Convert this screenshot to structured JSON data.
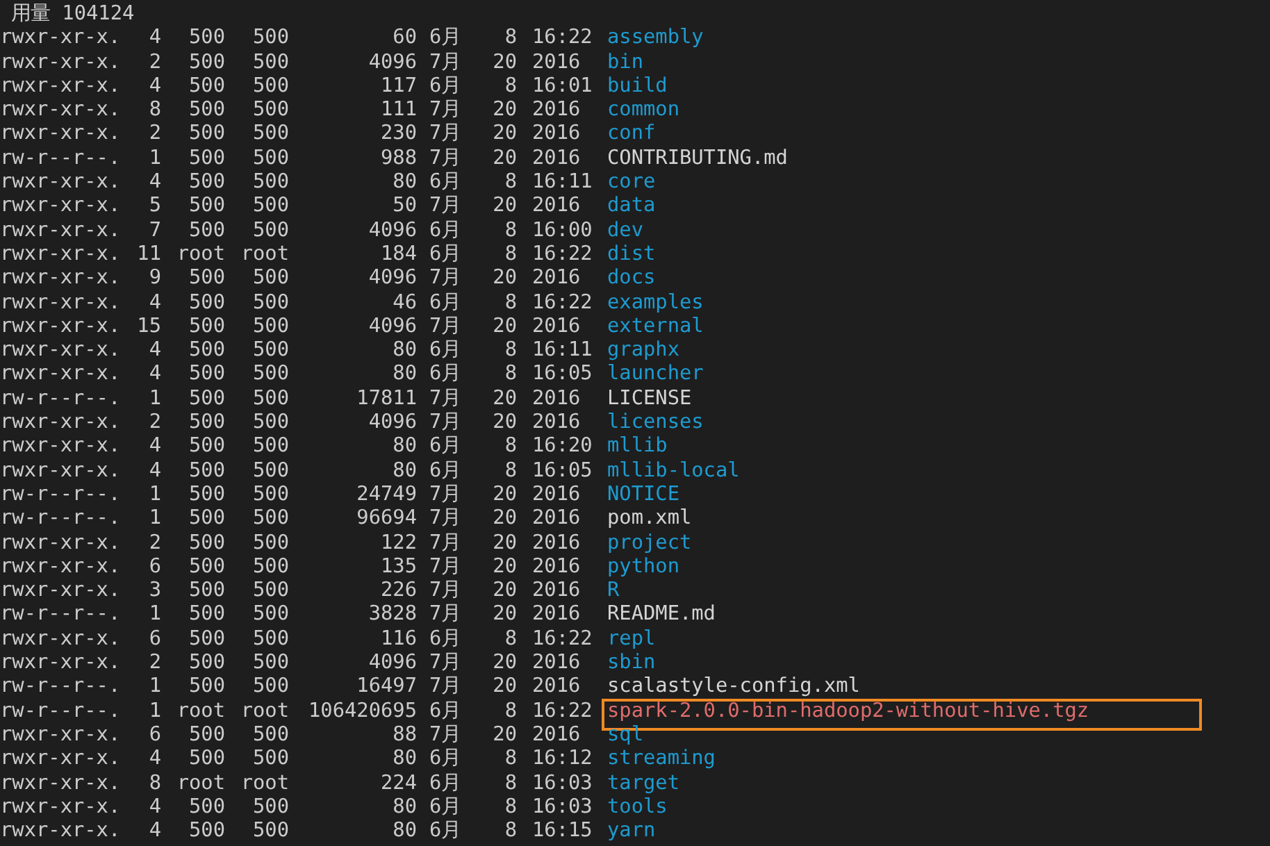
{
  "terminal": {
    "summary": "用量 104124",
    "rows": [
      {
        "permissions": "rwxr-xr-x.",
        "links": "4",
        "owner": "500",
        "group": "500",
        "size": "60",
        "month": "6月",
        "day": "8",
        "time": "16:22",
        "name": "assembly",
        "color": "#1e9bd0",
        "highlighted": false
      },
      {
        "permissions": "rwxr-xr-x.",
        "links": "2",
        "owner": "500",
        "group": "500",
        "size": "4096",
        "month": "7月",
        "day": "20",
        "time": "2016",
        "name": "bin",
        "color": "#1e9bd0",
        "highlighted": false
      },
      {
        "permissions": "rwxr-xr-x.",
        "links": "4",
        "owner": "500",
        "group": "500",
        "size": "117",
        "month": "6月",
        "day": "8",
        "time": "16:01",
        "name": "build",
        "color": "#1e9bd0",
        "highlighted": false
      },
      {
        "permissions": "rwxr-xr-x.",
        "links": "8",
        "owner": "500",
        "group": "500",
        "size": "111",
        "month": "7月",
        "day": "20",
        "time": "2016",
        "name": "common",
        "color": "#1e9bd0",
        "highlighted": false
      },
      {
        "permissions": "rwxr-xr-x.",
        "links": "2",
        "owner": "500",
        "group": "500",
        "size": "230",
        "month": "7月",
        "day": "20",
        "time": "2016",
        "name": "conf",
        "color": "#1e9bd0",
        "highlighted": false
      },
      {
        "permissions": "rw-r--r--.",
        "links": "1",
        "owner": "500",
        "group": "500",
        "size": "988",
        "month": "7月",
        "day": "20",
        "time": "2016",
        "name": "CONTRIBUTING.md",
        "color": "#d4d4d4",
        "highlighted": false
      },
      {
        "permissions": "rwxr-xr-x.",
        "links": "4",
        "owner": "500",
        "group": "500",
        "size": "80",
        "month": "6月",
        "day": "8",
        "time": "16:11",
        "name": "core",
        "color": "#1e9bd0",
        "highlighted": false
      },
      {
        "permissions": "rwxr-xr-x.",
        "links": "5",
        "owner": "500",
        "group": "500",
        "size": "50",
        "month": "7月",
        "day": "20",
        "time": "2016",
        "name": "data",
        "color": "#1e9bd0",
        "highlighted": false
      },
      {
        "permissions": "rwxr-xr-x.",
        "links": "7",
        "owner": "500",
        "group": "500",
        "size": "4096",
        "month": "6月",
        "day": "8",
        "time": "16:00",
        "name": "dev",
        "color": "#1e9bd0",
        "highlighted": false
      },
      {
        "permissions": "rwxr-xr-x.",
        "links": "11",
        "owner": "root",
        "group": "root",
        "size": "184",
        "month": "6月",
        "day": "8",
        "time": "16:22",
        "name": "dist",
        "color": "#1e9bd0",
        "highlighted": false
      },
      {
        "permissions": "rwxr-xr-x.",
        "links": "9",
        "owner": "500",
        "group": "500",
        "size": "4096",
        "month": "7月",
        "day": "20",
        "time": "2016",
        "name": "docs",
        "color": "#1e9bd0",
        "highlighted": false
      },
      {
        "permissions": "rwxr-xr-x.",
        "links": "4",
        "owner": "500",
        "group": "500",
        "size": "46",
        "month": "6月",
        "day": "8",
        "time": "16:22",
        "name": "examples",
        "color": "#1e9bd0",
        "highlighted": false
      },
      {
        "permissions": "rwxr-xr-x.",
        "links": "15",
        "owner": "500",
        "group": "500",
        "size": "4096",
        "month": "7月",
        "day": "20",
        "time": "2016",
        "name": "external",
        "color": "#1e9bd0",
        "highlighted": false
      },
      {
        "permissions": "rwxr-xr-x.",
        "links": "4",
        "owner": "500",
        "group": "500",
        "size": "80",
        "month": "6月",
        "day": "8",
        "time": "16:11",
        "name": "graphx",
        "color": "#1e9bd0",
        "highlighted": false
      },
      {
        "permissions": "rwxr-xr-x.",
        "links": "4",
        "owner": "500",
        "group": "500",
        "size": "80",
        "month": "6月",
        "day": "8",
        "time": "16:05",
        "name": "launcher",
        "color": "#1e9bd0",
        "highlighted": false
      },
      {
        "permissions": "rw-r--r--.",
        "links": "1",
        "owner": "500",
        "group": "500",
        "size": "17811",
        "month": "7月",
        "day": "20",
        "time": "2016",
        "name": "LICENSE",
        "color": "#d4d4d4",
        "highlighted": false
      },
      {
        "permissions": "rwxr-xr-x.",
        "links": "2",
        "owner": "500",
        "group": "500",
        "size": "4096",
        "month": "7月",
        "day": "20",
        "time": "2016",
        "name": "licenses",
        "color": "#1e9bd0",
        "highlighted": false
      },
      {
        "permissions": "rwxr-xr-x.",
        "links": "4",
        "owner": "500",
        "group": "500",
        "size": "80",
        "month": "6月",
        "day": "8",
        "time": "16:20",
        "name": "mllib",
        "color": "#1e9bd0",
        "highlighted": false
      },
      {
        "permissions": "rwxr-xr-x.",
        "links": "4",
        "owner": "500",
        "group": "500",
        "size": "80",
        "month": "6月",
        "day": "8",
        "time": "16:05",
        "name": "mllib-local",
        "color": "#1e9bd0",
        "highlighted": false
      },
      {
        "permissions": "rw-r--r--.",
        "links": "1",
        "owner": "500",
        "group": "500",
        "size": "24749",
        "month": "7月",
        "day": "20",
        "time": "2016",
        "name": "NOTICE",
        "color": "#1e9bd0",
        "highlighted": false
      },
      {
        "permissions": "rw-r--r--.",
        "links": "1",
        "owner": "500",
        "group": "500",
        "size": "96694",
        "month": "7月",
        "day": "20",
        "time": "2016",
        "name": "pom.xml",
        "color": "#d4d4d4",
        "highlighted": false
      },
      {
        "permissions": "rwxr-xr-x.",
        "links": "2",
        "owner": "500",
        "group": "500",
        "size": "122",
        "month": "7月",
        "day": "20",
        "time": "2016",
        "name": "project",
        "color": "#1e9bd0",
        "highlighted": false
      },
      {
        "permissions": "rwxr-xr-x.",
        "links": "6",
        "owner": "500",
        "group": "500",
        "size": "135",
        "month": "7月",
        "day": "20",
        "time": "2016",
        "name": "python",
        "color": "#1e9bd0",
        "highlighted": false
      },
      {
        "permissions": "rwxr-xr-x.",
        "links": "3",
        "owner": "500",
        "group": "500",
        "size": "226",
        "month": "7月",
        "day": "20",
        "time": "2016",
        "name": "R",
        "color": "#1e9bd0",
        "highlighted": false
      },
      {
        "permissions": "rw-r--r--.",
        "links": "1",
        "owner": "500",
        "group": "500",
        "size": "3828",
        "month": "7月",
        "day": "20",
        "time": "2016",
        "name": "README.md",
        "color": "#d4d4d4",
        "highlighted": false
      },
      {
        "permissions": "rwxr-xr-x.",
        "links": "6",
        "owner": "500",
        "group": "500",
        "size": "116",
        "month": "6月",
        "day": "8",
        "time": "16:22",
        "name": "repl",
        "color": "#1e9bd0",
        "highlighted": false
      },
      {
        "permissions": "rwxr-xr-x.",
        "links": "2",
        "owner": "500",
        "group": "500",
        "size": "4096",
        "month": "7月",
        "day": "20",
        "time": "2016",
        "name": "sbin",
        "color": "#1e9bd0",
        "highlighted": false
      },
      {
        "permissions": "rw-r--r--.",
        "links": "1",
        "owner": "500",
        "group": "500",
        "size": "16497",
        "month": "7月",
        "day": "20",
        "time": "2016",
        "name": "scalastyle-config.xml",
        "color": "#d4d4d4",
        "highlighted": false
      },
      {
        "permissions": "rw-r--r--.",
        "links": "1",
        "owner": "root",
        "group": "root",
        "size": "106420695",
        "month": "6月",
        "day": "8",
        "time": "16:22",
        "name": "spark-2.0.0-bin-hadoop2-without-hive.tgz",
        "color": "#e06c6c",
        "highlighted": true
      },
      {
        "permissions": "rwxr-xr-x.",
        "links": "6",
        "owner": "500",
        "group": "500",
        "size": "88",
        "month": "7月",
        "day": "20",
        "time": "2016",
        "name": "sql",
        "color": "#1e9bd0",
        "highlighted": false
      },
      {
        "permissions": "rwxr-xr-x.",
        "links": "4",
        "owner": "500",
        "group": "500",
        "size": "80",
        "month": "6月",
        "day": "8",
        "time": "16:12",
        "name": "streaming",
        "color": "#1e9bd0",
        "highlighted": false
      },
      {
        "permissions": "rwxr-xr-x.",
        "links": "8",
        "owner": "root",
        "group": "root",
        "size": "224",
        "month": "6月",
        "day": "8",
        "time": "16:03",
        "name": "target",
        "color": "#1e9bd0",
        "highlighted": false
      },
      {
        "permissions": "rwxr-xr-x.",
        "links": "4",
        "owner": "500",
        "group": "500",
        "size": "80",
        "month": "6月",
        "day": "8",
        "time": "16:03",
        "name": "tools",
        "color": "#1e9bd0",
        "highlighted": false
      },
      {
        "permissions": "rwxr-xr-x.",
        "links": "4",
        "owner": "500",
        "group": "500",
        "size": "80",
        "month": "6月",
        "day": "8",
        "time": "16:15",
        "name": "yarn",
        "color": "#1e9bd0",
        "highlighted": false
      }
    ]
  }
}
